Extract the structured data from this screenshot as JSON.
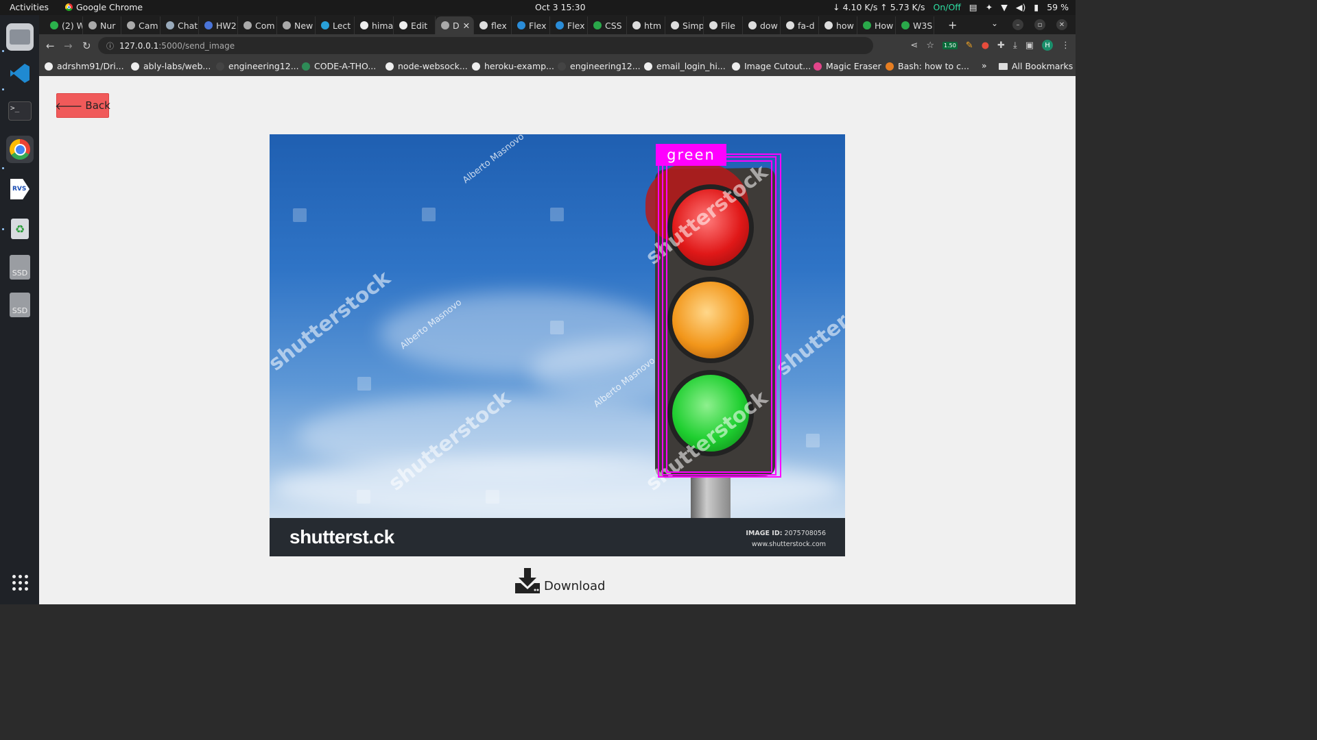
{
  "system_bar": {
    "activities": "Activities",
    "app_name": "Google Chrome",
    "clock": "Oct 3  15:30",
    "net_speed": "↓ 4.10 K/s ↑ 5.73 K/s",
    "vpn_toggle": "On/Off",
    "battery": "59 %"
  },
  "dock": {
    "items": [
      "files",
      "vscode",
      "terminal",
      "chrome",
      "rvs-app",
      "trash",
      "ssd-drive-1",
      "ssd-drive-2",
      "show-apps"
    ],
    "ssd_label": "SSD"
  },
  "tabs": [
    {
      "label": "(2) W"
    },
    {
      "label": "Nur"
    },
    {
      "label": "Cam"
    },
    {
      "label": "Chat"
    },
    {
      "label": "HW2"
    },
    {
      "label": "Com"
    },
    {
      "label": "New"
    },
    {
      "label": "Lect"
    },
    {
      "label": "hima"
    },
    {
      "label": "Edit"
    },
    {
      "label": "D",
      "active": true
    },
    {
      "label": "flex"
    },
    {
      "label": "Flex"
    },
    {
      "label": "Flex"
    },
    {
      "label": "CSS"
    },
    {
      "label": "htm"
    },
    {
      "label": "Simp"
    },
    {
      "label": "File"
    },
    {
      "label": "dow"
    },
    {
      "label": "fa-d"
    },
    {
      "label": "how"
    },
    {
      "label": "How"
    },
    {
      "label": "W3S"
    }
  ],
  "address_bar": {
    "host": "127.0.0.1",
    "path": ":5000/send_image",
    "extension_badge": "1.50",
    "profile_initial": "H"
  },
  "bookmarks": [
    "adrshm91/Dri...",
    "ably-labs/web...",
    "engineering12...",
    "CODE-A-THO...",
    "node-websock...",
    "heroku-examp...",
    "engineering12...",
    "email_login_hi...",
    "Image Cutout...",
    "Magic Eraser",
    "Bash: how to c..."
  ],
  "bookmarks_overflow": "»",
  "all_bookmarks": "All Bookmarks",
  "page": {
    "back_label": "Back",
    "detection_label": "green",
    "watermark_text": "shutterstock",
    "photographer": "Alberto Masnovo",
    "stock_logo": "shutterst.ck",
    "image_id_label": "IMAGE ID:",
    "image_id": "2075708056",
    "stock_url": "www.shutterstock.com",
    "download_label": "Download",
    "colors": {
      "back_button": "#f05a5a",
      "bbox": "#ff00ff"
    }
  }
}
